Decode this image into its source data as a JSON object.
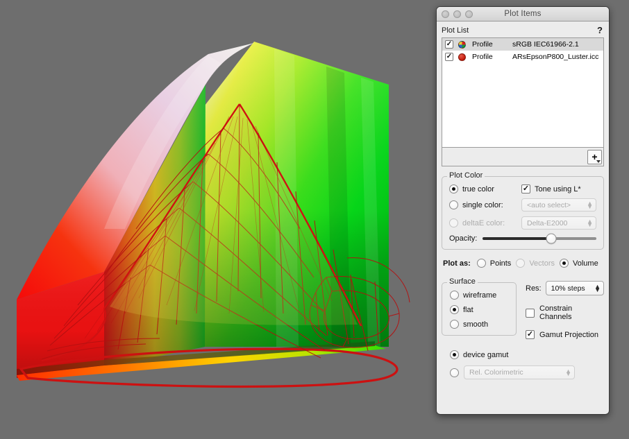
{
  "window": {
    "title": "Plot Items",
    "traffic_lights": [
      "close-button",
      "minimize-button",
      "zoom-button"
    ]
  },
  "plot_list": {
    "header_label": "Plot List",
    "help_label": "?",
    "columns": [
      "enabled",
      "swatch",
      "kind",
      "name"
    ],
    "rows": [
      {
        "checked": true,
        "swatch": "rgb-sphere-icon",
        "kind": "Profile",
        "name": "sRGB IEC61966-2.1",
        "selected": true
      },
      {
        "checked": true,
        "swatch": "red-sphere-icon",
        "kind": "Profile",
        "name": "ARsEpsonP800_Luster.icc",
        "selected": false
      }
    ],
    "add_button_label": "+"
  },
  "plot_color": {
    "group_title": "Plot Color",
    "true_color": {
      "label": "true color",
      "selected": true
    },
    "single_color": {
      "label": "single color:",
      "selected": false,
      "value": "<auto select>",
      "disabled": true
    },
    "deltae_color": {
      "label": "deltaE color:",
      "selected": false,
      "value": "Delta-E2000",
      "disabled": true
    },
    "tone_using_l": {
      "label": "Tone using L*",
      "checked": true
    },
    "opacity": {
      "label": "Opacity:",
      "value": 60
    }
  },
  "plot_as": {
    "label": "Plot as:",
    "options": [
      {
        "label": "Points",
        "selected": false,
        "disabled": false
      },
      {
        "label": "Vectors",
        "selected": false,
        "disabled": true
      },
      {
        "label": "Volume",
        "selected": true,
        "disabled": false
      }
    ]
  },
  "surface": {
    "group_title": "Surface",
    "options": [
      {
        "label": "wireframe",
        "selected": false
      },
      {
        "label": "flat",
        "selected": true
      },
      {
        "label": "smooth",
        "selected": false
      }
    ]
  },
  "resolution": {
    "label": "Res:",
    "value": "10% steps"
  },
  "constrain_channels": {
    "label": "Constrain Channels",
    "checked": false
  },
  "gamut_projection": {
    "label": "Gamut Projection",
    "checked": true
  },
  "gamut_mode": {
    "device_gamut": {
      "label": "device gamut",
      "selected": true
    },
    "intent": {
      "selected": false,
      "value": "Rel. Colorimetric",
      "disabled": true
    }
  },
  "colors": {
    "background": "#6e6e6e",
    "window_chrome": "#ececec",
    "list_selection": "#d9d9d9",
    "wireframe_red": "#c41515",
    "srgb_green": "#00d41e",
    "srgb_red": "#f01010",
    "srgb_yellow": "#e8f000"
  }
}
